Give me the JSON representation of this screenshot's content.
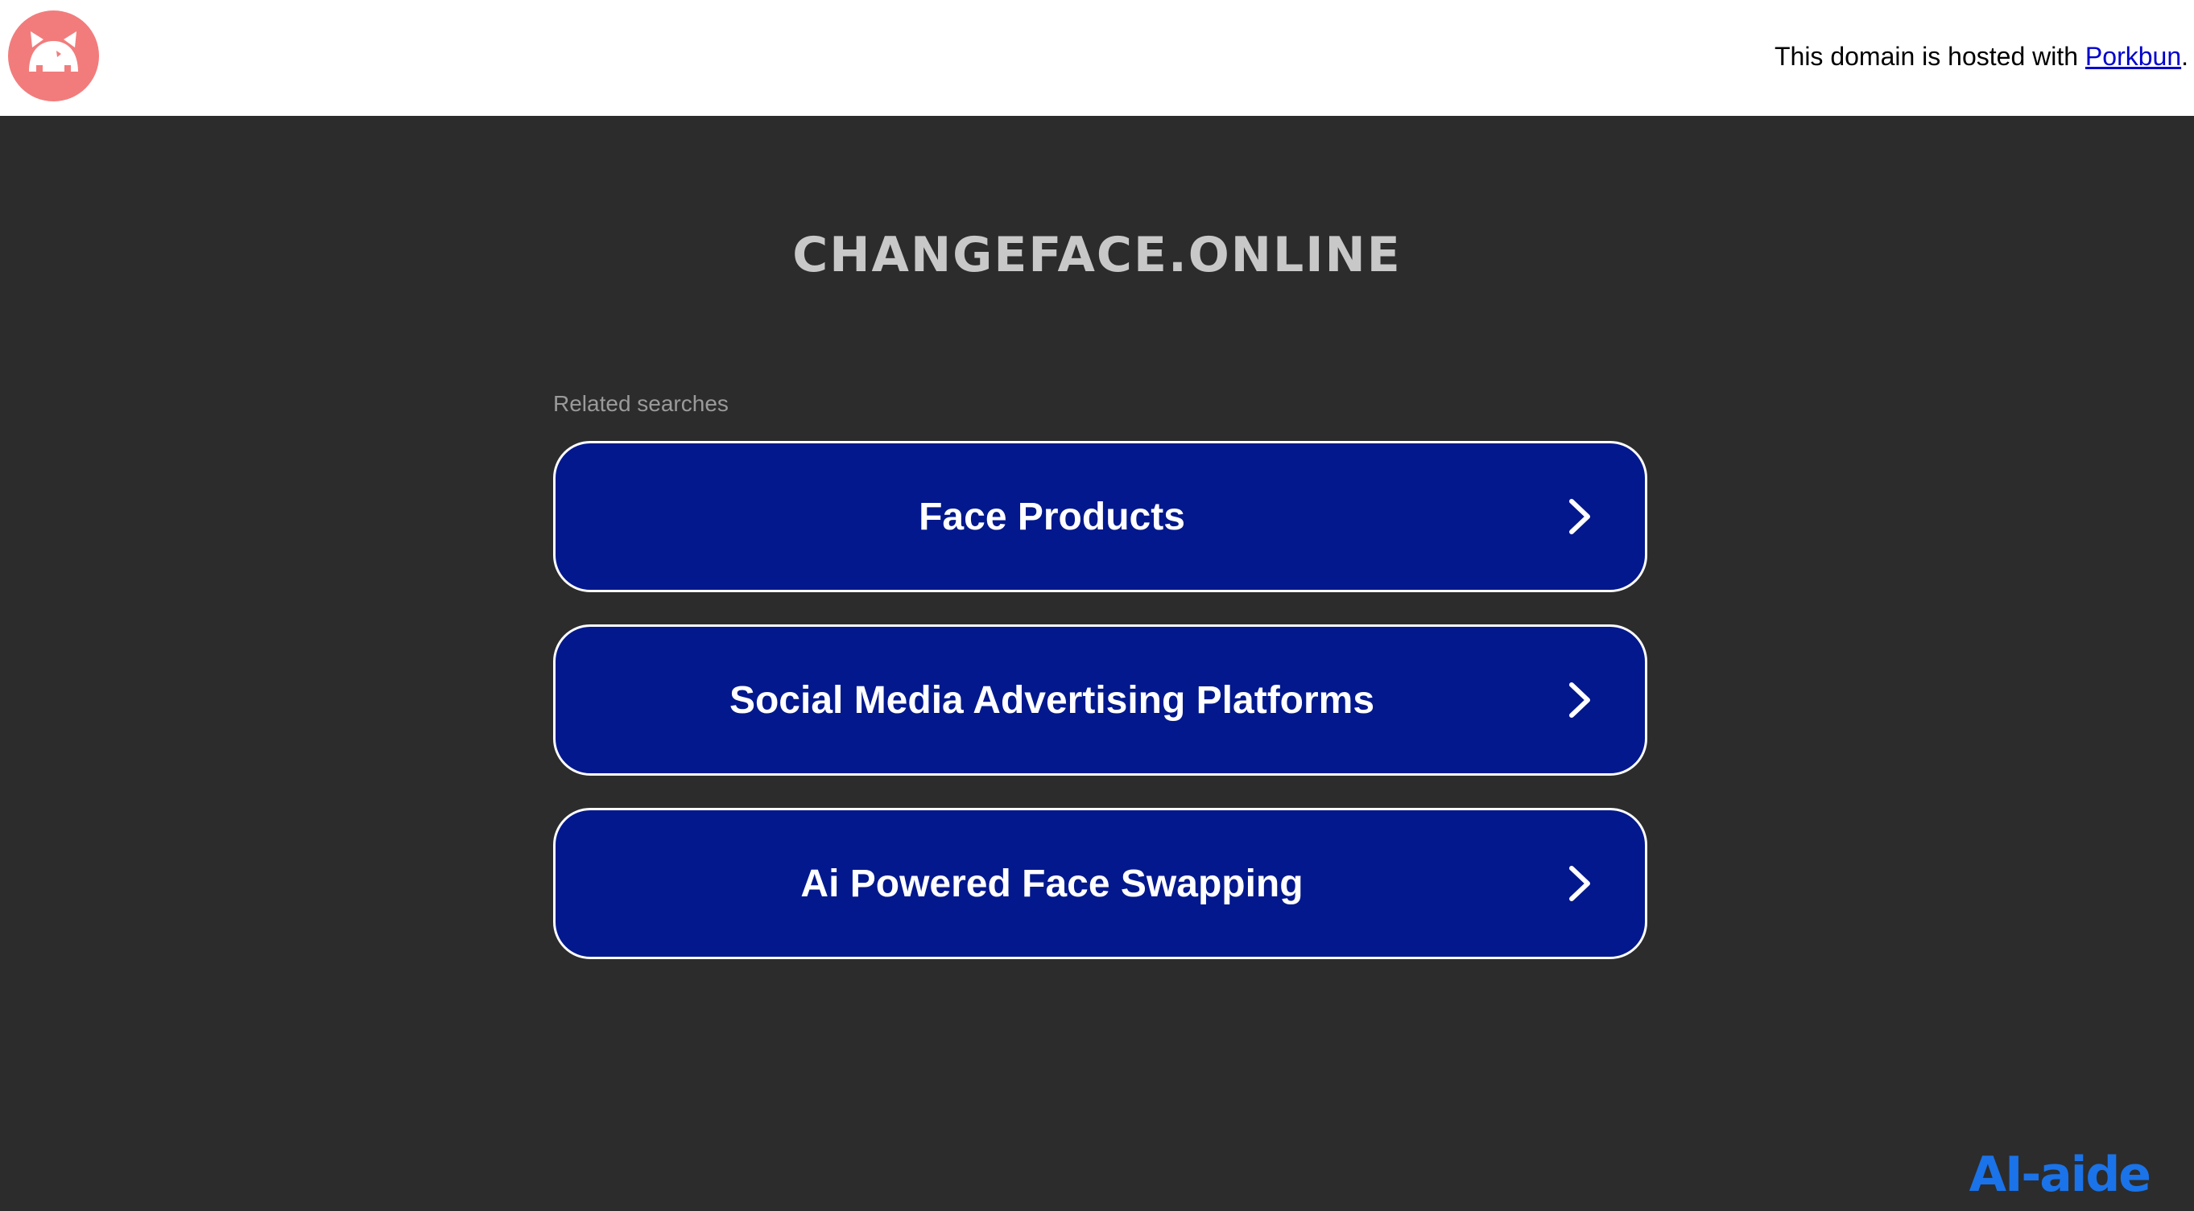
{
  "header": {
    "logo_icon": "porkbun-pig-icon",
    "hosted_prefix": "This domain is hosted with ",
    "hosted_link": "Porkbun",
    "hosted_suffix": "."
  },
  "main": {
    "domain_title": "CHANGEFACE.ONLINE",
    "related_label": "Related searches",
    "searches": [
      {
        "label": "Face Products",
        "icon": "chevron-right-icon"
      },
      {
        "label": "Social Media Advertising Platforms",
        "icon": "chevron-right-icon"
      },
      {
        "label": "Ai Powered Face Swapping",
        "icon": "chevron-right-icon"
      }
    ]
  },
  "watermark": {
    "text": "AI-aide"
  },
  "colors": {
    "background": "#2c2c2c",
    "topbar": "#ffffff",
    "button": "#03188c",
    "button_border": "#ffffff",
    "title": "#c8c8c8",
    "logo": "#f27c7c",
    "link": "#0000cc",
    "watermark": "#1a73e8"
  }
}
